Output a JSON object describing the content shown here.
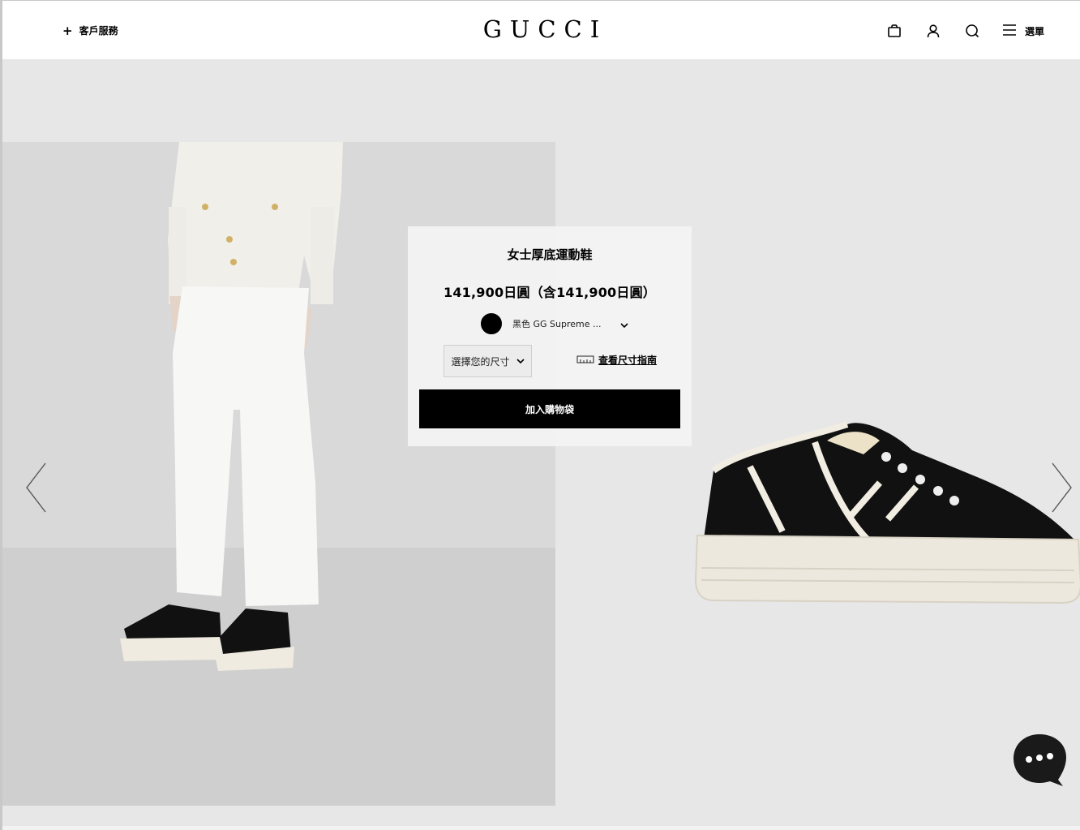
{
  "header": {
    "customer_service_label": "客戶服務",
    "logo_text": "GUCCI",
    "menu_label": "選單"
  },
  "product": {
    "title": "女士厚底運動鞋",
    "price": "141,900日圓（含141,900日圓）",
    "color_label": "黑色 GG Supreme ...",
    "size_placeholder": "選擇您的尺寸",
    "size_guide_label": "查看尺寸指南",
    "add_to_bag_label": "加入購物袋"
  },
  "colors": {
    "hero_background": "#e7e7e8",
    "button_black": "#000000",
    "swatch_black": "#000000"
  },
  "icons": [
    "plus-icon",
    "shopping-bag-icon",
    "user-icon",
    "search-icon",
    "hamburger-menu-icon",
    "chevron-down-icon",
    "ruler-icon",
    "chevron-left-icon",
    "chevron-right-icon",
    "chat-icon"
  ]
}
